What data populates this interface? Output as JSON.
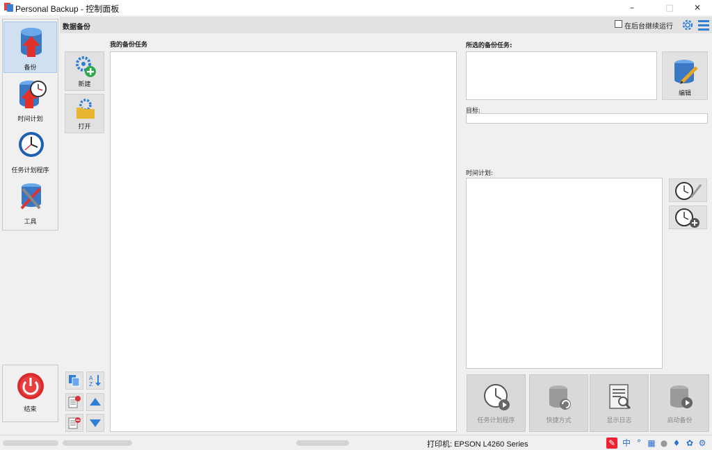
{
  "window": {
    "title": "Personal Backup - 控制面板",
    "minimize": "–",
    "maximize": "□",
    "close": "✕"
  },
  "header": {
    "section_title": "数据备份",
    "background_checkbox_label": "在后台继续运行",
    "background_checked": false
  },
  "nav": {
    "items": [
      {
        "label": "备份",
        "icon": "database-upload-icon",
        "active": true
      },
      {
        "label": "时间计划",
        "icon": "database-clock-icon",
        "active": false
      },
      {
        "label": "任务计划程序",
        "icon": "clock-icon",
        "active": false
      },
      {
        "label": "工具",
        "icon": "tools-icon",
        "active": false
      }
    ],
    "quit_label": "结束"
  },
  "tools": {
    "new_label": "新建",
    "open_label": "打开"
  },
  "tasks": {
    "my_tasks_label": "我的备份任务",
    "selected_task_label": "所选的备份任务:",
    "edit_label": "编辑",
    "target_label": "目标:",
    "target_value": "",
    "schedule_label": "时间计划:"
  },
  "actions": [
    {
      "label": "任务计划程序",
      "icon": "clock-play-icon"
    },
    {
      "label": "快捷方式",
      "icon": "shortcut-icon"
    },
    {
      "label": "显示日志",
      "icon": "log-search-icon"
    },
    {
      "label": "启动备份",
      "icon": "database-play-icon"
    }
  ],
  "status": {
    "printer": "打印机: EPSON L4260 Series"
  },
  "colors": {
    "accent_blue": "#2f7fd6",
    "active_nav_bg": "#cfe0f2",
    "quit_red": "#d92b2b"
  }
}
